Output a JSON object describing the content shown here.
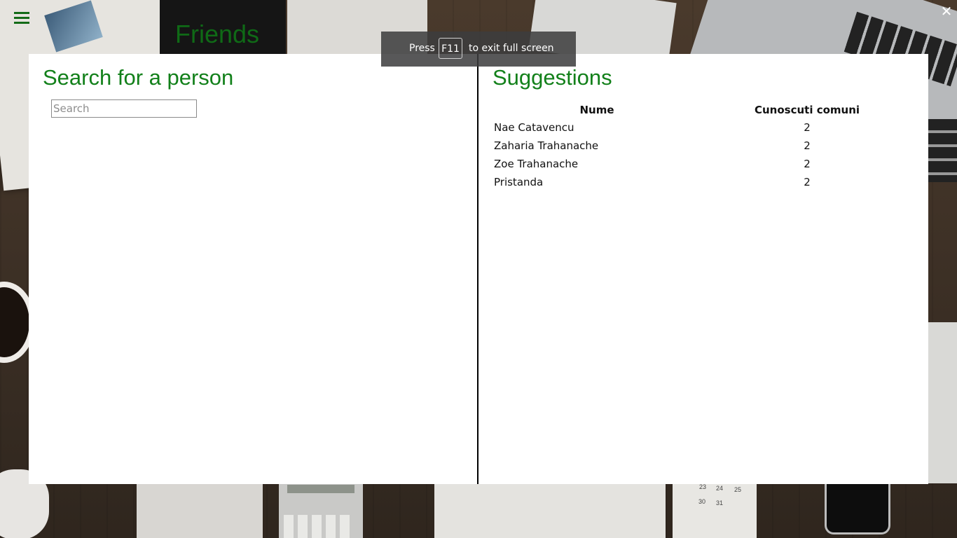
{
  "background": {
    "faded_title": "Friends",
    "calendar_numbers": [
      "23",
      "24",
      "25",
      "30",
      "31"
    ]
  },
  "topbar": {
    "menu_icon": "hamburger-menu-icon",
    "close_icon": "close-icon",
    "close_glyph": "✕",
    "accent_color": "#12801a"
  },
  "search_panel": {
    "title": "Search for a person",
    "input_placeholder": "Search",
    "input_value": ""
  },
  "suggestions_panel": {
    "title": "Suggestions",
    "columns": [
      "Nume",
      "Cunoscuti comuni"
    ],
    "rows": [
      {
        "name": "Nae Catavencu",
        "count": "2"
      },
      {
        "name": "Zaharia Trahanache",
        "count": "2"
      },
      {
        "name": "Zoe Trahanache",
        "count": "2"
      },
      {
        "name": "Pristanda",
        "count": "2"
      }
    ]
  },
  "fullscreen_toast": {
    "prefix": "Press",
    "key": "F11",
    "suffix": "to exit full screen"
  }
}
